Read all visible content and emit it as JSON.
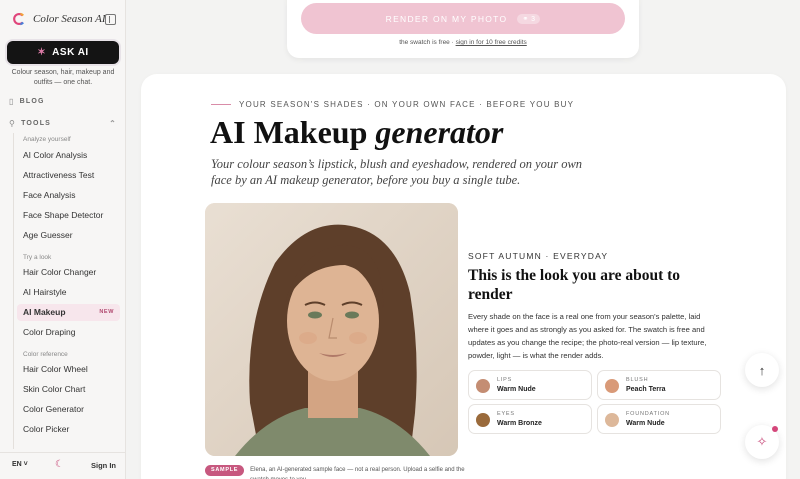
{
  "sidebar": {
    "brand_name": "Color Season AI",
    "ask_label": "ASK AI",
    "tagline": "Colour season, hair, makeup and outfits — one chat.",
    "blog_label": "BLOG",
    "tools_label": "TOOLS",
    "groups": {
      "analyze": "Analyze yourself",
      "try": "Try a look",
      "reference": "Color reference"
    },
    "items": [
      {
        "label": "AI Color Analysis"
      },
      {
        "label": "Attractiveness Test"
      },
      {
        "label": "Face Analysis"
      },
      {
        "label": "Face Shape Detector"
      },
      {
        "label": "Age Guesser"
      },
      {
        "label": "Hair Color Changer"
      },
      {
        "label": "AI Hairstyle"
      },
      {
        "label": "AI Makeup",
        "badge": "NEW"
      },
      {
        "label": "Color Draping"
      },
      {
        "label": "Hair Color Wheel"
      },
      {
        "label": "Skin Color Chart"
      },
      {
        "label": "Color Generator"
      },
      {
        "label": "Color Picker"
      }
    ],
    "footer": {
      "lang": "EN",
      "signin": "Sign In"
    }
  },
  "top_card": {
    "render_label": "RENDER ON MY PHOTO",
    "credit_cost": "3",
    "note_prefix": "the swatch is free · ",
    "note_link": "sign in for 10 free credits"
  },
  "hero": {
    "eyebrow": "YOUR SEASON'S SHADES · ON YOUR OWN FACE · BEFORE YOU BUY",
    "title_plain": "AI Makeup ",
    "title_italic": "generator",
    "subtitle": "Your colour season’s lipstick, blush and eyeshadow, rendered on your own face by an AI makeup generator, before you buy a single tube."
  },
  "sample": {
    "badge": "SAMPLE",
    "caption": "Elena, an AI-generated sample face — not a real person. Upload a selfie and the swatch moves to you."
  },
  "look": {
    "eyebrow": "SOFT AUTUMN · EVERYDAY",
    "title": "This is the look you are about to render",
    "body": "Every shade on the face is a real one from your season's palette, laid where it goes and as strongly as you asked for. The swatch is free and updates as you change the recipe; the photo-real version — lip texture, powder, light — is what the render adds.",
    "swatches": [
      {
        "label": "LIPS",
        "value": "Warm Nude",
        "color": "#c48d73"
      },
      {
        "label": "BLUSH",
        "value": "Peach Terra",
        "color": "#d99a78"
      },
      {
        "label": "EYES",
        "value": "Warm Bronze",
        "color": "#9a6a3b"
      },
      {
        "label": "FOUNDATION",
        "value": "Warm Nude",
        "color": "#ddb89a"
      }
    ]
  },
  "colors": {
    "accent": "#c84a7a",
    "render_button": "#f0c4d2"
  }
}
